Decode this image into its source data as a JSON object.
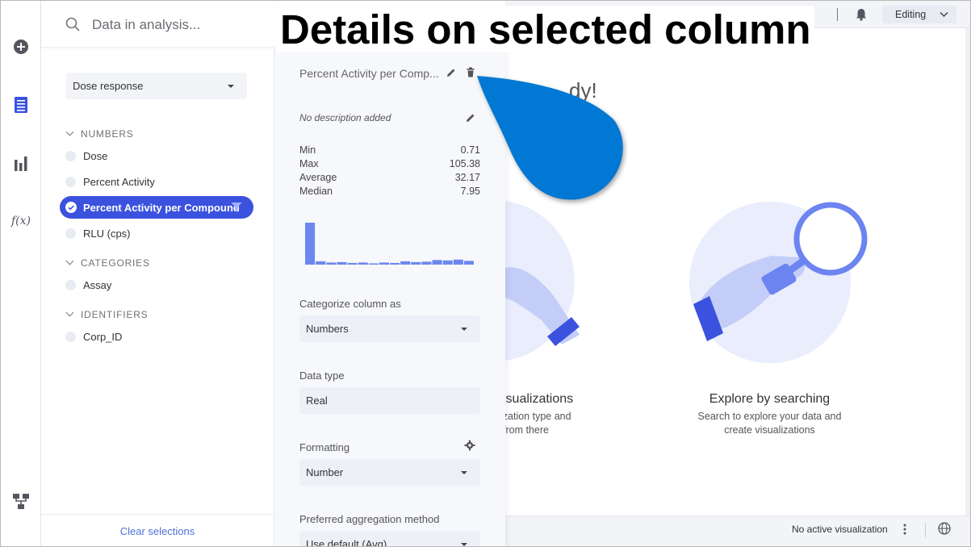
{
  "header": {
    "title": "Details on selected column"
  },
  "search": {
    "placeholder": "Data in analysis..."
  },
  "table_selector": {
    "value": "Dose response"
  },
  "groups": {
    "numbers": "NUMBERS",
    "categories": "CATEGORIES",
    "identifiers": "IDENTIFIERS"
  },
  "columns": {
    "dose": "Dose",
    "percent_activity": "Percent Activity",
    "percent_activity_per_compound": "Percent Activity per Compound",
    "rlu": "RLU (cps)",
    "assay": "Assay",
    "corp_id": "Corp_ID"
  },
  "clear_selections": "Clear selections",
  "details": {
    "column_name": "Percent Activity per Comp...",
    "description": "No description added",
    "stats": [
      {
        "label": "Min",
        "value": "0.71"
      },
      {
        "label": "Max",
        "value": "105.38"
      },
      {
        "label": "Average",
        "value": "32.17"
      },
      {
        "label": "Median",
        "value": "7.95"
      }
    ],
    "histogram": [
      1.0,
      0.08,
      0.05,
      0.06,
      0.04,
      0.05,
      0.03,
      0.05,
      0.04,
      0.08,
      0.06,
      0.07,
      0.11,
      0.1,
      0.12,
      0.09
    ],
    "categorize_label": "Categorize column as",
    "categorize_value": "Numbers",
    "datatype_label": "Data type",
    "datatype_value": "Real",
    "formatting_label": "Formatting",
    "formatting_value": "Number",
    "aggregation_label": "Preferred aggregation method",
    "aggregation_value": "Use default (Avg)"
  },
  "topbar": {
    "mode": "Editing"
  },
  "canvas": {
    "ready_fragment": "dy!",
    "card1_title": "isualizations",
    "card1_line1": "ization type and",
    "card1_line2": "from there",
    "card2_title": "Explore by searching",
    "card2_line1": "Search to explore your data and",
    "card2_line2": "create visualizations"
  },
  "status": {
    "text": "No active visualization"
  },
  "colors": {
    "accent": "#3b52df",
    "callout": "#0078d4",
    "illustration": "#e9edfc"
  }
}
